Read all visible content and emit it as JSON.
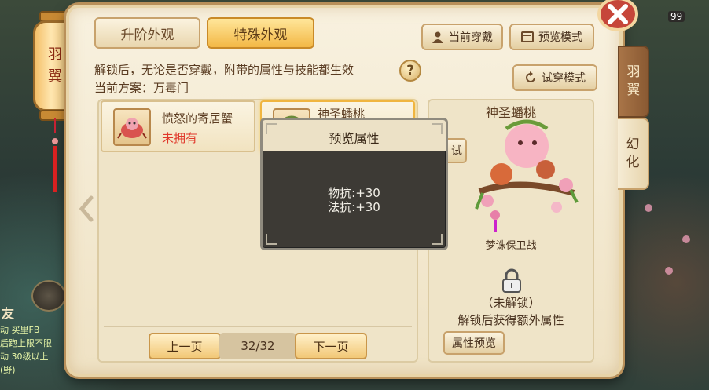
{
  "tabs": {
    "upgrade_label": "升阶外观",
    "special_label": "特殊外观"
  },
  "toolbar": {
    "wear_label": "当前穿戴",
    "preview_label": "预览模式",
    "try_label": "试穿模式"
  },
  "info": {
    "line1": "解锁后，无论是否穿戴，附带的属性与技能都生效",
    "line2": "当前方案：万毒门",
    "help": "?"
  },
  "lantern": {
    "text": "羽\n翼"
  },
  "items": [
    {
      "name": "愤怒的寄居蟹",
      "status": "未拥有"
    },
    {
      "name": "神圣蟠桃"
    }
  ],
  "pager": {
    "prev_label": "上一页",
    "page": "32/32",
    "next_label": "下一页"
  },
  "detail": {
    "title": "神圣蟠桃",
    "map": "梦诛保卫战",
    "locked": "（未解锁）",
    "hint": "解锁后获得额外属性",
    "attr_button": "属性预览",
    "try_stub": "试"
  },
  "side_tabs": {
    "wing": "羽\n翼",
    "magic": "幻\n化"
  },
  "tooltip": {
    "title": "预览属性",
    "lines": [
      "物抗:+30",
      "法抗:+30"
    ]
  },
  "hud": {
    "friend": "友",
    "level": "99",
    "chat_lines": [
      "动 买里FB",
      "后跑上限不限",
      "动 30级以上",
      "(野)"
    ]
  },
  "colors": {
    "accent": "#f3b846",
    "status_red": "#e0382a",
    "panel": "#f8f1df"
  }
}
